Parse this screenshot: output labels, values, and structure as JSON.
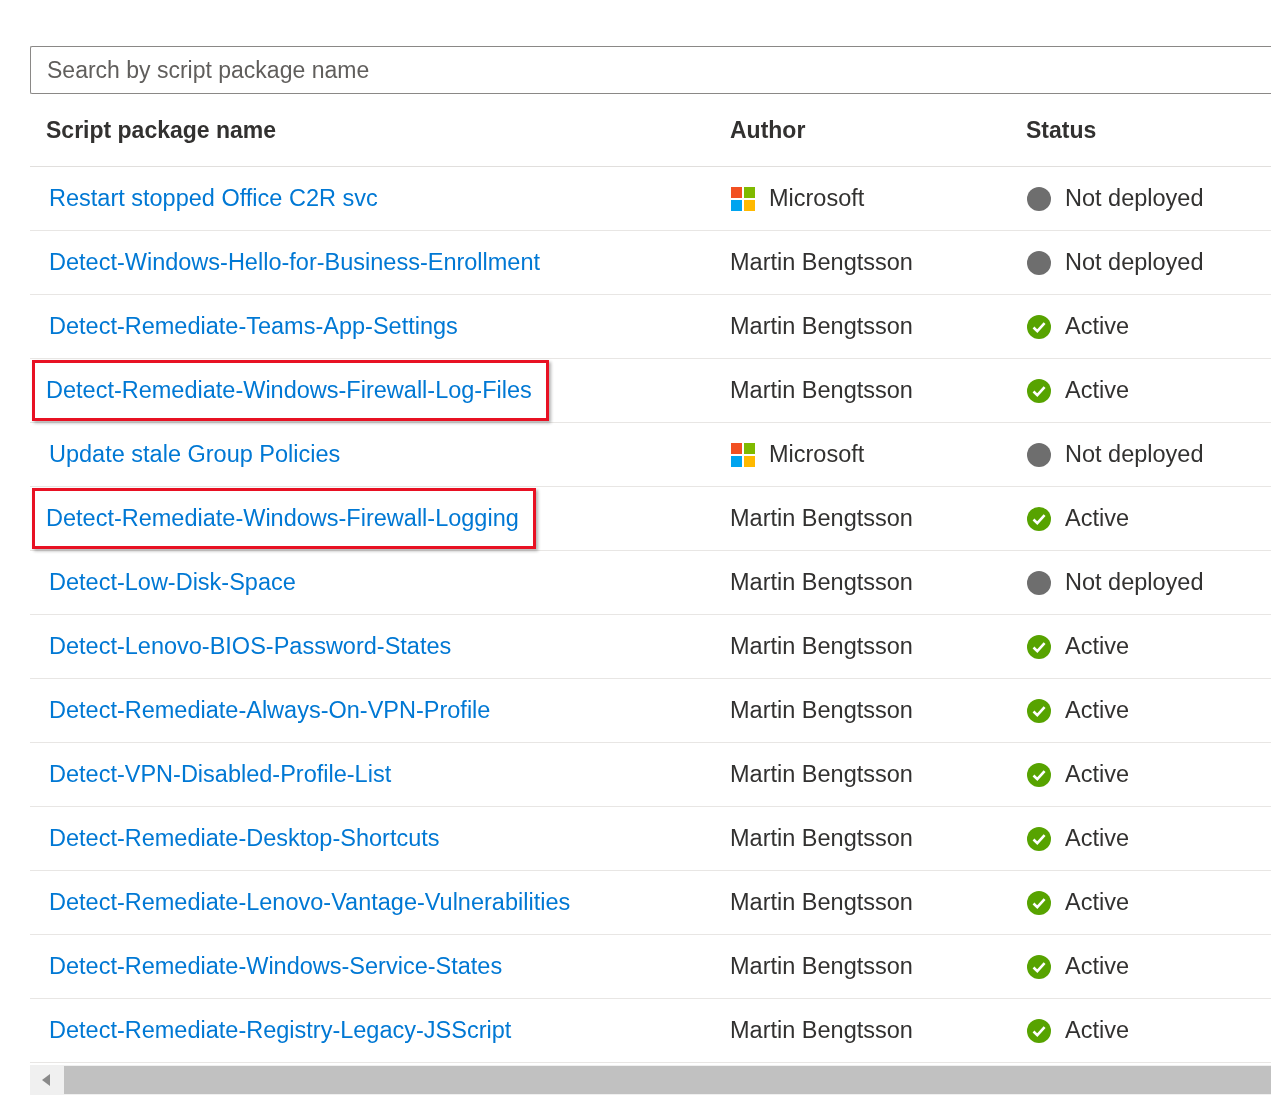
{
  "search": {
    "placeholder": "Search by script package name"
  },
  "table": {
    "columns": [
      "Script package name",
      "Author",
      "Status"
    ],
    "rows": [
      {
        "name": "Restart stopped Office C2R svc",
        "author": "Microsoft",
        "author_logo": true,
        "status": "Not deployed",
        "kind": "not-deployed",
        "highlighted": false
      },
      {
        "name": "Detect-Windows-Hello-for-Business-Enrollment",
        "author": "Martin Bengtsson",
        "author_logo": false,
        "status": "Not deployed",
        "kind": "not-deployed",
        "highlighted": false
      },
      {
        "name": "Detect-Remediate-Teams-App-Settings",
        "author": "Martin Bengtsson",
        "author_logo": false,
        "status": "Active",
        "kind": "active",
        "highlighted": false
      },
      {
        "name": "Detect-Remediate-Windows-Firewall-Log-Files",
        "author": "Martin Bengtsson",
        "author_logo": false,
        "status": "Active",
        "kind": "active",
        "highlighted": true
      },
      {
        "name": "Update stale Group Policies",
        "author": "Microsoft",
        "author_logo": true,
        "status": "Not deployed",
        "kind": "not-deployed",
        "highlighted": false
      },
      {
        "name": "Detect-Remediate-Windows-Firewall-Logging",
        "author": "Martin Bengtsson",
        "author_logo": false,
        "status": "Active",
        "kind": "active",
        "highlighted": true
      },
      {
        "name": "Detect-Low-Disk-Space",
        "author": "Martin Bengtsson",
        "author_logo": false,
        "status": "Not deployed",
        "kind": "not-deployed",
        "highlighted": false
      },
      {
        "name": "Detect-Lenovo-BIOS-Password-States",
        "author": "Martin Bengtsson",
        "author_logo": false,
        "status": "Active",
        "kind": "active",
        "highlighted": false
      },
      {
        "name": "Detect-Remediate-Always-On-VPN-Profile",
        "author": "Martin Bengtsson",
        "author_logo": false,
        "status": "Active",
        "kind": "active",
        "highlighted": false
      },
      {
        "name": "Detect-VPN-Disabled-Profile-List",
        "author": "Martin Bengtsson",
        "author_logo": false,
        "status": "Active",
        "kind": "active",
        "highlighted": false
      },
      {
        "name": "Detect-Remediate-Desktop-Shortcuts",
        "author": "Martin Bengtsson",
        "author_logo": false,
        "status": "Active",
        "kind": "active",
        "highlighted": false
      },
      {
        "name": "Detect-Remediate-Lenovo-Vantage-Vulnerabilities",
        "author": "Martin Bengtsson",
        "author_logo": false,
        "status": "Active",
        "kind": "active",
        "highlighted": false
      },
      {
        "name": "Detect-Remediate-Windows-Service-States",
        "author": "Martin Bengtsson",
        "author_logo": false,
        "status": "Active",
        "kind": "active",
        "highlighted": false
      },
      {
        "name": "Detect-Remediate-Registry-Legacy-JSScript",
        "author": "Martin Bengtsson",
        "author_logo": false,
        "status": "Active",
        "kind": "active",
        "highlighted": false
      }
    ]
  }
}
